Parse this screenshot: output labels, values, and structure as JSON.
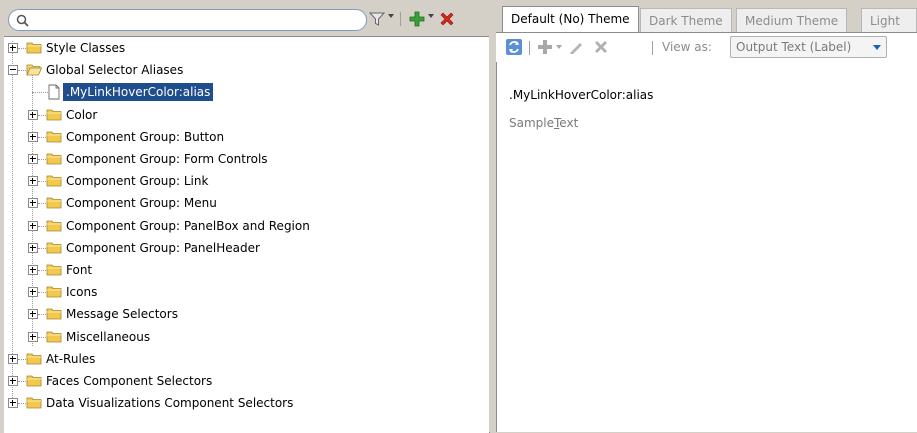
{
  "search": {
    "value": "",
    "placeholder": ""
  },
  "tree": {
    "items": [
      {
        "label": "Style Classes"
      },
      {
        "label": "Global Selector Aliases"
      },
      {
        "label": ".MyLinkHoverColor:alias"
      },
      {
        "label": "Color"
      },
      {
        "label": "Component Group: Button"
      },
      {
        "label": "Component Group: Form Controls"
      },
      {
        "label": "Component Group: Link"
      },
      {
        "label": "Component Group: Menu"
      },
      {
        "label": "Component Group: PanelBox and Region"
      },
      {
        "label": "Component Group: PanelHeader"
      },
      {
        "label": "Font"
      },
      {
        "label": "Icons"
      },
      {
        "label": "Message Selectors"
      },
      {
        "label": "Miscellaneous"
      },
      {
        "label": "At-Rules"
      },
      {
        "label": "Faces Component Selectors"
      },
      {
        "label": "Data Visualizations Component Selectors"
      }
    ]
  },
  "tabs": [
    {
      "label": "Default (No) Theme"
    },
    {
      "label": "Dark Theme"
    },
    {
      "label": "Medium Theme"
    },
    {
      "label": "Light"
    }
  ],
  "toolbar": {
    "view_as_label": "View as:",
    "view_as_value": "Output Text (Label)"
  },
  "preview": {
    "selector": ".MyLinkHoverColor:alias",
    "sample_text": "SampleText",
    "sample_prefix": "Sample",
    "sample_mnemonic": "T",
    "sample_suffix": "ext"
  },
  "colors": {
    "selection": "#1f4e8f",
    "add_green": "#2e9a2e",
    "delete_red": "#d42a1a",
    "folder": "#f2c94c"
  }
}
